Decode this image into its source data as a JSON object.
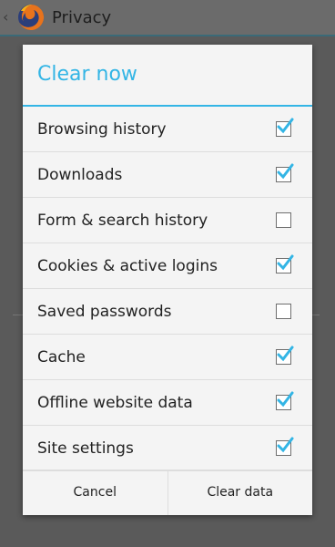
{
  "header": {
    "title": "Privacy",
    "back_icon": "chevron-left-icon",
    "logo_icon": "firefox-logo"
  },
  "dialog": {
    "title": "Clear now",
    "options": [
      {
        "label": "Browsing history",
        "checked": true
      },
      {
        "label": "Downloads",
        "checked": true
      },
      {
        "label": "Form & search history",
        "checked": false
      },
      {
        "label": "Cookies & active logins",
        "checked": true
      },
      {
        "label": "Saved passwords",
        "checked": false
      },
      {
        "label": "Cache",
        "checked": true
      },
      {
        "label": "Offline website data",
        "checked": true
      },
      {
        "label": "Site settings",
        "checked": true
      }
    ],
    "cancel_label": "Cancel",
    "confirm_label": "Clear data"
  },
  "colors": {
    "accent": "#33b5e5",
    "text": "#222222",
    "scrim": "#5a5a5a"
  }
}
